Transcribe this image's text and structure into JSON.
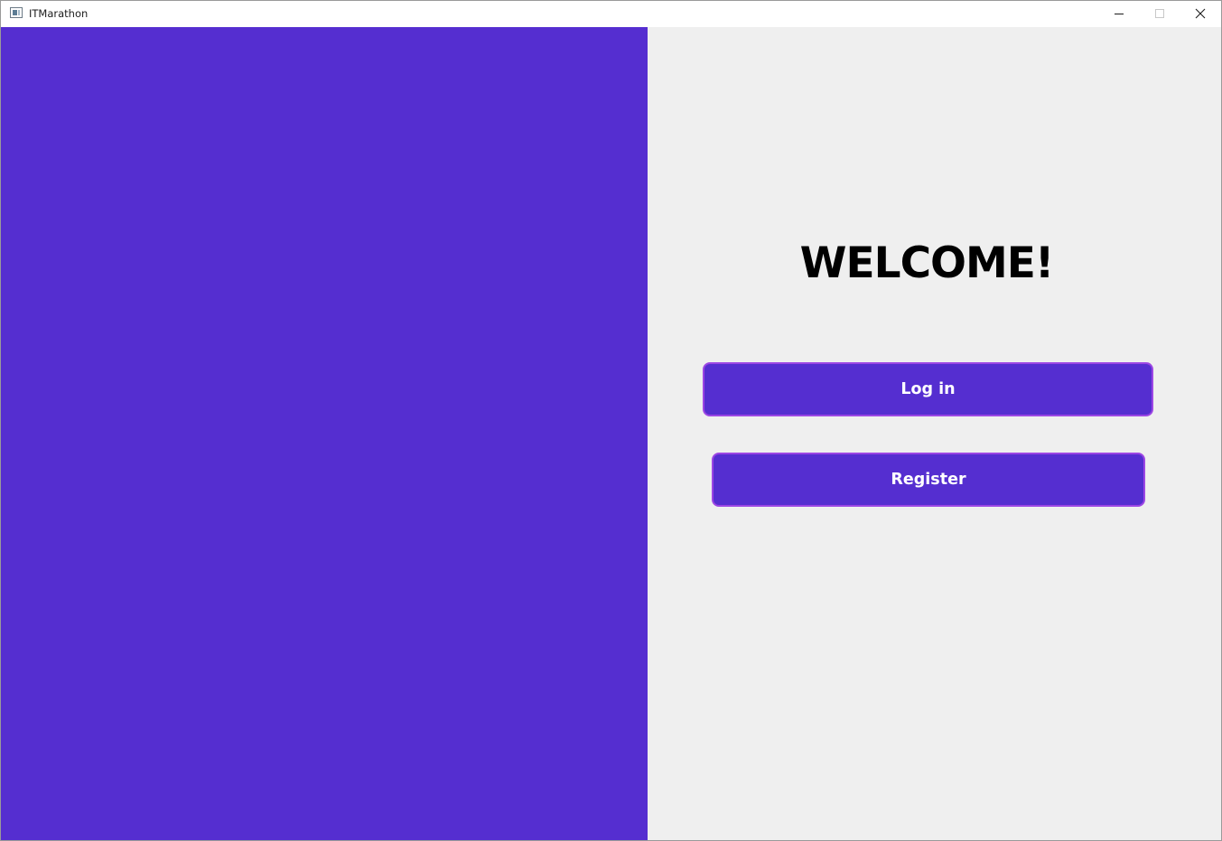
{
  "window": {
    "title": "ITMarathon",
    "icon": "app-window-icon",
    "controls": {
      "minimize_icon": "minimize-icon",
      "maximize_icon": "maximize-icon",
      "close_icon": "close-icon"
    }
  },
  "welcome_screen": {
    "heading": "WELCOME!",
    "login_label": "Log in",
    "register_label": "Register"
  },
  "colors": {
    "brand_purple": "#552ed0",
    "button_border": "#9c46e4",
    "panel_background": "#efefef",
    "heading_text": "#000000",
    "button_text": "#ffffff"
  }
}
